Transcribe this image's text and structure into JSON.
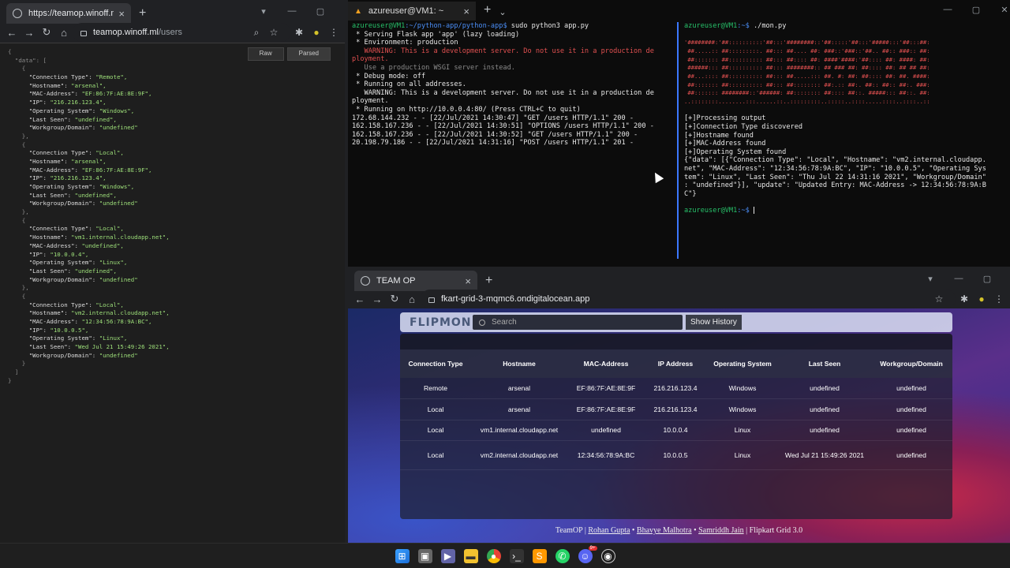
{
  "left_browser": {
    "tab_title": "https://teamop.winoff.ml/users",
    "url_domain": "teamop.winoff.ml",
    "url_path": "/users",
    "view_tabs": [
      "Raw",
      "Parsed"
    ],
    "json_lines": [
      {
        "t": "{"
      },
      {
        "t": "  \"data\": ["
      },
      {
        "t": "    {"
      },
      {
        "k": "Connection Type",
        "v": "Remote"
      },
      {
        "k": "Hostname",
        "v": "arsenal"
      },
      {
        "k": "MAC-Address",
        "v": "EF:86:7F:AE:8E:9F"
      },
      {
        "k": "IP",
        "v": "216.216.123.4"
      },
      {
        "k": "Operating System",
        "v": "Windows"
      },
      {
        "k": "Last Seen",
        "v": "undefined"
      },
      {
        "k": "Workgroup/Domain",
        "v": "undefined",
        "last": true
      },
      {
        "t": "    },"
      },
      {
        "t": "    {"
      },
      {
        "k": "Connection Type",
        "v": "Local"
      },
      {
        "k": "Hostname",
        "v": "arsenal"
      },
      {
        "k": "MAC-Address",
        "v": "EF:86:7F:AE:8E:9F"
      },
      {
        "k": "IP",
        "v": "216.216.123.4"
      },
      {
        "k": "Operating System",
        "v": "Windows"
      },
      {
        "k": "Last Seen",
        "v": "undefined"
      },
      {
        "k": "Workgroup/Domain",
        "v": "undefined",
        "last": true
      },
      {
        "t": "    },"
      },
      {
        "t": "    {"
      },
      {
        "k": "Connection Type",
        "v": "Local"
      },
      {
        "k": "Hostname",
        "v": "vm1.internal.cloudapp.net"
      },
      {
        "k": "MAC-Address",
        "v": "undefined"
      },
      {
        "k": "IP",
        "v": "10.0.0.4"
      },
      {
        "k": "Operating System",
        "v": "Linux"
      },
      {
        "k": "Last Seen",
        "v": "undefined"
      },
      {
        "k": "Workgroup/Domain",
        "v": "undefined",
        "last": true
      },
      {
        "t": "    },"
      },
      {
        "t": "    {"
      },
      {
        "k": "Connection Type",
        "v": "Local"
      },
      {
        "k": "Hostname",
        "v": "vm2.internal.cloudapp.net"
      },
      {
        "k": "MAC-Address",
        "v": "12:34:56:78:9A:BC"
      },
      {
        "k": "IP",
        "v": "10.0.0.5"
      },
      {
        "k": "Operating System",
        "v": "Linux"
      },
      {
        "k": "Last Seen",
        "v": "Wed Jul 21 15:49:26 2021"
      },
      {
        "k": "Workgroup/Domain",
        "v": "undefined",
        "last": true
      },
      {
        "t": "    }"
      },
      {
        "t": "  ]"
      },
      {
        "t": "}"
      }
    ]
  },
  "terminal": {
    "tab_title": "azureuser@VM1: ~",
    "left_pane": {
      "prompt_user": "azureuser@VM1",
      "prompt_path": ":~/python-app/python-app$",
      "command": " sudo python3 app.py",
      "lines": [
        {
          "text": " * Serving Flask app 'app' (lazy loading)"
        },
        {
          "text": " * Environment: production"
        },
        {
          "text": "   WARNING: This is a development server. Do not use it in a production de",
          "cls": "red"
        },
        {
          "text": "ployment.",
          "cls": "red"
        },
        {
          "text": "   Use a production WSGI server instead.",
          "cls": "dim"
        },
        {
          "text": " * Debug mode: off"
        },
        {
          "text": " * Running on all addresses."
        },
        {
          "text": "   WARNING: This is a development server. Do not use it in a production de"
        },
        {
          "text": "ployment."
        },
        {
          "text": " * Running on http://10.0.0.4:80/ (Press CTRL+C to quit)"
        },
        {
          "text": "172.68.144.232 - - [22/Jul/2021 14:30:47] \"GET /users HTTP/1.1\" 200 -"
        },
        {
          "text": "162.158.167.236 - - [22/Jul/2021 14:30:51] \"OPTIONS /users HTTP/1.1\" 200 -"
        },
        {
          "text": "162.158.167.236 - - [22/Jul/2021 14:30:52] \"GET /users HTTP/1.1\" 200 -"
        },
        {
          "text": "20.198.79.186 - - [22/Jul/2021 14:31:16] \"POST /users HTTP/1.1\" 201 -"
        }
      ]
    },
    "right_pane": {
      "prompt_user": "azureuser@VM1",
      "prompt_path": ":~$",
      "command": " ./mon.py",
      "banner": [
        "'########:'##::::::::::'##:::'########::'##:::::'##:::'#####:::'##:::##:",
        " ##.....:: ##:::::::::. ##::: ##.... ##: ###::'###::'##.. ##:: ###:: ##:",
        " ##::::::: ##:::::::::: ##::: ##:::: ##: ####'####:'##:::: ##: ####: ##:",
        " ######::: ##:::::::::: ##::: ########:: ## ### ##: ##:::: ##: ## ## ##:",
        " ##...:::: ##:::::::::: ##::: ##.....::: ##. #: ##: ##:::: ##: ##. ####:",
        " ##::::::: ##:::::::::: ##::: ##:::::::: ##:.:: ##:. ##:: ##:: ##:. ###:",
        " ##::::::: ########::'######: ##:::::::: ##:::: ##::. #####::: ##::. ##:",
        "..::::::::........:::......::..:::::::::..:::::..::::.....::::..::::..::"
      ],
      "output": [
        "[+]Processing output",
        "[+]Connection Type discovered",
        "[+]Hostname found",
        "[+]MAC-Address found",
        "[+]Operating System found",
        "{\"data\": [{\"Connection Type\": \"Local\", \"Hostname\": \"vm2.internal.cloudapp.",
        "net\", \"MAC-Address\": \"12:34:56:78:9A:BC\", \"IP\": \"10.0.0.5\", \"Operating Sys",
        "tem\": \"Linux\", \"Last Seen\": \"Thu Jul 22 14:31:16 2021\", \"Workgroup/Domain\"",
        ": \"undefined\"}], \"update\": \"Updated Entry: MAC-Address -> 12:34:56:78:9A:B",
        "C\"}"
      ],
      "final_prompt_path": ":~$"
    }
  },
  "app_browser": {
    "tab_title": "TEAM OP",
    "url": "fkart-grid-3-mqmc6.ondigitalocean.app",
    "logo": "FLIPMON",
    "search_placeholder": "Search",
    "show_history_label": "Show History",
    "columns": [
      "Connection Type",
      "Hostname",
      "MAC-Address",
      "IP Address",
      "Operating System",
      "Last Seen",
      "Workgroup/Domain"
    ],
    "rows": [
      [
        "Remote",
        "arsenal",
        "EF:86:7F:AE:8E:9F",
        "216.216.123.4",
        "Windows",
        "undefined",
        "undefined"
      ],
      [
        "Local",
        "arsenal",
        "EF:86:7F:AE:8E:9F",
        "216.216.123.4",
        "Windows",
        "undefined",
        "undefined"
      ],
      [
        "Local",
        "vm1.internal.cloudapp.net",
        "undefined",
        "10.0.0.4",
        "Linux",
        "undefined",
        "undefined"
      ],
      [
        "Local",
        "vm2.internal.cloudapp.net",
        "12:34:56:78:9A:BC",
        "10.0.0.5",
        "Linux",
        "Wed Jul 21 15:49:26 2021",
        "undefined"
      ]
    ],
    "footer": {
      "team": "TeamOP",
      "members": [
        "Rohan Gupta",
        "Bhavye Malhotra",
        "Samriddh Jain"
      ],
      "event": "Flipkart Grid 3.0"
    }
  },
  "taskbar": {
    "icons": [
      "windows-start-icon",
      "task-view-icon",
      "teams-chat-icon",
      "file-explorer-icon",
      "chrome-icon",
      "terminal-icon",
      "sublime-text-icon",
      "whatsapp-icon",
      "discord-icon",
      "github-icon"
    ],
    "discord_badge": "9+"
  },
  "colors": {
    "terminal_bg": "#0c0c0c",
    "prompt_green": "#27c26a",
    "path_blue": "#4a8df5",
    "warning_red": "#e05050",
    "json_value_green": "#9ee07a"
  }
}
